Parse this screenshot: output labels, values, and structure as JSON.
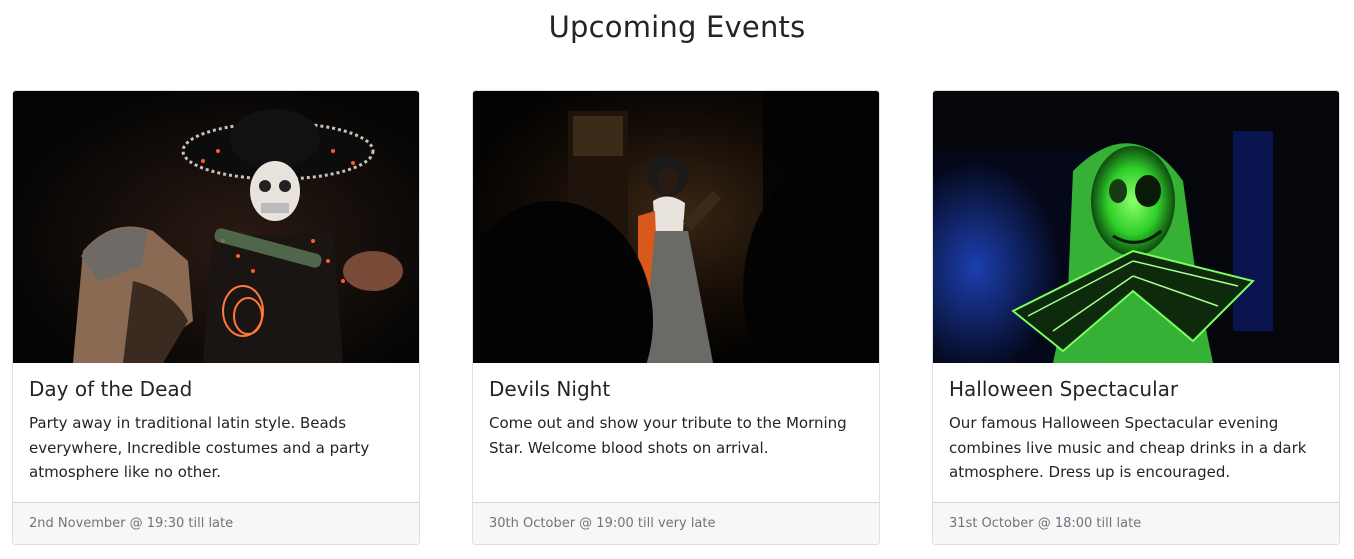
{
  "page": {
    "title": "Upcoming Events"
  },
  "events": [
    {
      "title": "Day of the Dead",
      "description": "Party away in traditional latin style. Beads everywhere, Incredible costumes and a party atmosphere like no other.",
      "date": "2nd November @ 19:30 till late",
      "image": "day-of-the-dead-photo"
    },
    {
      "title": "Devils Night",
      "description": "Come out and show your tribute to the Morning Star. Welcome blood shots on arrival.",
      "date": "30th October @ 19:00 till very late",
      "image": "devils-night-photo"
    },
    {
      "title": "Halloween Spectacular",
      "description": "Our famous Halloween Spectacular evening combines live music and cheap drinks in a dark atmosphere. Dress up is encouraged.",
      "date": "31st October @ 18:00 till late",
      "image": "halloween-spectacular-photo"
    }
  ],
  "colors": {
    "text": "#212529",
    "muted": "#6c757d",
    "footer_bg": "#f7f7f7"
  }
}
